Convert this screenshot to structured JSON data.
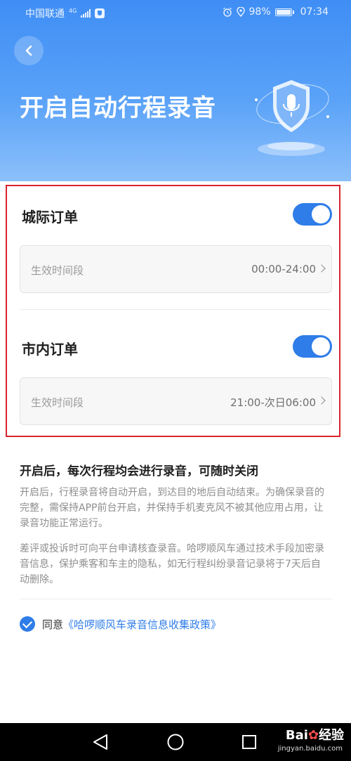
{
  "status_bar": {
    "carrier": "中国联通",
    "network": "4G",
    "battery": "98%",
    "time": "07:34",
    "icons": [
      "shield-app-icon",
      "alarm-icon",
      "location-icon",
      "battery-icon",
      "signal-icon"
    ]
  },
  "header": {
    "back_icon": "back-arrow-icon",
    "title": "开启自动行程录音",
    "illustration_icon": "microphone-shield-icon"
  },
  "orders": [
    {
      "title": "城际订单",
      "enabled": true,
      "time_label": "生效时间段",
      "time_value": "00:00-24:00"
    },
    {
      "title": "市内订单",
      "enabled": true,
      "time_label": "生效时间段",
      "time_value": "21:00-次日06:00"
    }
  ],
  "info": {
    "heading": "开启后，每次行程均会进行录音，可随时关闭",
    "paragraph1": "开启后，行程录音将自动开启，到达目的地后自动结束。为确保录音的完整，需保持APP前台开启，并保持手机麦克风不被其他应用占用，让录音功能正常运行。",
    "paragraph2": "差评或投诉时可向平台申请核查录音。哈啰顺风车通过技术手段加密录音信息，保护乘客和车主的隐私，如无行程纠纷录音记录将于7天后自动删除。"
  },
  "agreement": {
    "checked": true,
    "prefix": "同意",
    "link": "《哈啰顺风车录音信息收集政策》"
  },
  "nav": {
    "icons": [
      "back-triangle-icon",
      "home-circle-icon",
      "recents-square-icon"
    ]
  },
  "watermark": {
    "brand": "Bai",
    "brand_suffix": "经验",
    "url": "jingyan.baidu.com"
  },
  "colors": {
    "accent": "#2f7de8",
    "header_top": "#3f8ef5",
    "highlight_border": "#d9252e"
  }
}
